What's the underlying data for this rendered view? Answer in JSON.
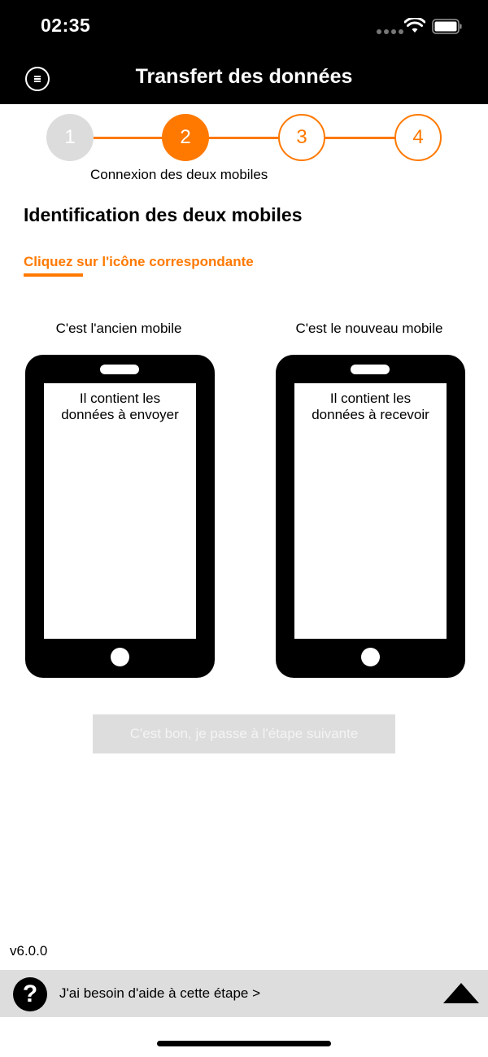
{
  "status_bar": {
    "time": "02:35"
  },
  "header": {
    "title": "Transfert des données",
    "menu_icon": "menu-icon"
  },
  "stepper": {
    "steps": [
      {
        "label": "1",
        "state": "done"
      },
      {
        "label": "2",
        "state": "active"
      },
      {
        "label": "3",
        "state": "todo"
      },
      {
        "label": "4",
        "state": "todo"
      }
    ],
    "caption": "Connexion des deux mobiles"
  },
  "section_title": "Identification des deux mobiles",
  "hint": "Cliquez sur l'icône correspondante",
  "phones": {
    "old": {
      "caption": "C'est l'ancien mobile",
      "screen_line1": "Il contient les",
      "screen_line2": "données à envoyer"
    },
    "new": {
      "caption": "C'est le nouveau mobile",
      "screen_line1": "Il contient les",
      "screen_line2": "données à recevoir"
    }
  },
  "next_button": {
    "label": "C'est bon, je passe à l'étape suivante"
  },
  "version": "v6.0.0",
  "help_bar": {
    "icon_text": "?",
    "text": "J'ai besoin d'aide à cette étape >"
  },
  "colors": {
    "accent": "#ff7900",
    "header_bg": "#000000",
    "disabled_bg": "#dddddd"
  }
}
